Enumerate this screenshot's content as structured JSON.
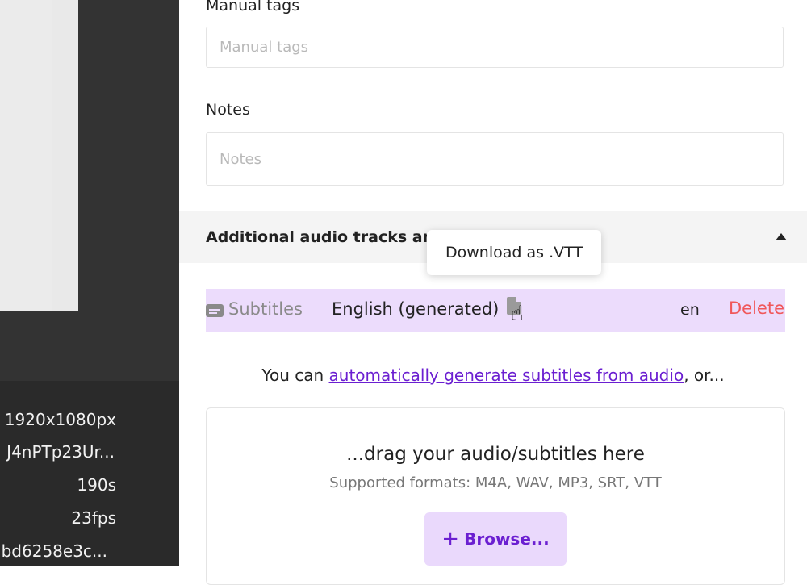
{
  "left_panel": {
    "metadata": [
      "1920x1080px",
      "J4nPTp23Ur...",
      "190s",
      "23fps",
      "bd6258e3c..."
    ]
  },
  "form": {
    "manual_tags_label": "Manual tags",
    "manual_tags_placeholder": "Manual tags",
    "notes_label": "Notes",
    "notes_placeholder": "Notes"
  },
  "section": {
    "title": "Additional audio tracks and subtitles"
  },
  "tooltip": {
    "text": "Download as .VTT"
  },
  "track": {
    "icon": "subtitles-icon",
    "type": "Subtitles",
    "name": "English (generated)",
    "download_icon": "file-icon",
    "language": "en",
    "delete_label": "Delete"
  },
  "auto_generate": {
    "prefix": "You can ",
    "link": "automatically generate subtitles from audio",
    "suffix": ", or..."
  },
  "dropzone": {
    "title": "...drag your audio/subtitles here",
    "formats": "Supported formats: M4A, WAV, MP3, SRT, VTT",
    "browse_label": "Browse...",
    "browse_icon": "plus-icon"
  },
  "colors": {
    "accent": "#6b1fd1",
    "track_bg": "#ecdcfc",
    "delete": "#f0575a"
  }
}
